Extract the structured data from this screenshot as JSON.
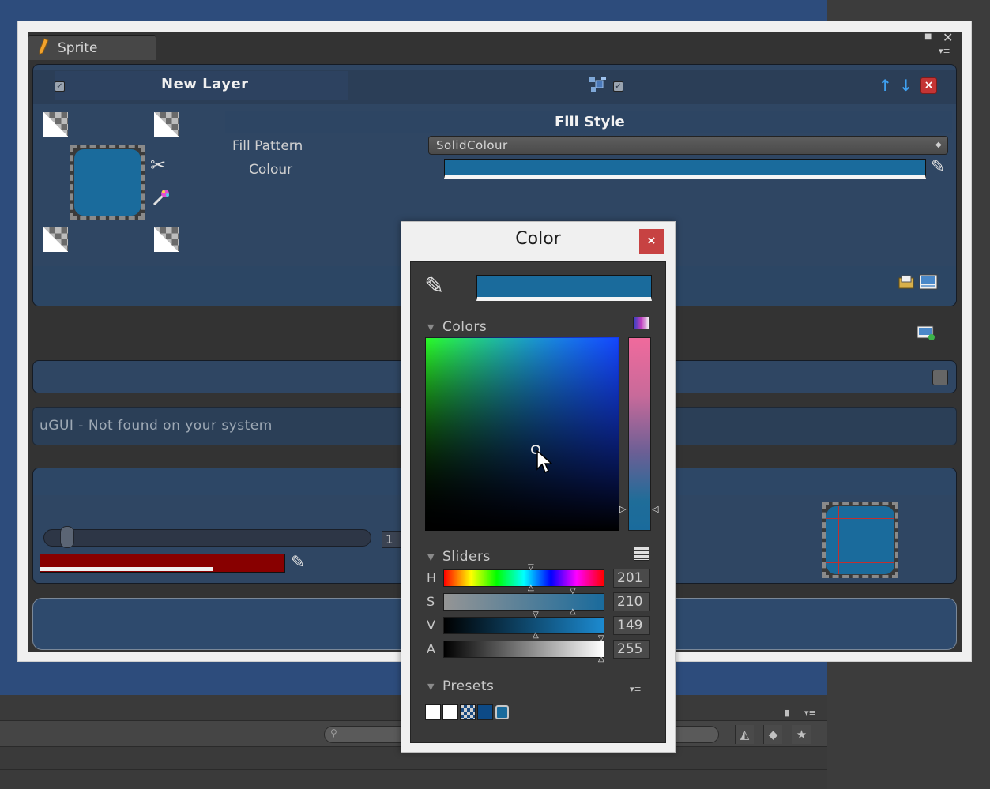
{
  "sprite_window": {
    "tab_title": "Sprite",
    "layer": {
      "name": "New Layer",
      "enabled": true,
      "fill_style_title": "Fill Style",
      "fill_pattern_label": "Fill Pattern",
      "fill_pattern_value": "SolidColour",
      "colour_label": "Colour",
      "colour_hex": "#1a6b9c"
    },
    "ugui_message": "uGUI - Not found on your system",
    "size_value": "1",
    "secondary_colour_hex": "#880000"
  },
  "color_dialog": {
    "title": "Color",
    "close_label": "×",
    "current_colour_hex": "#1a6b9c",
    "sections": {
      "colors": "Colors",
      "sliders": "Sliders",
      "presets": "Presets"
    },
    "sliders": [
      {
        "letter": "H",
        "value": "201"
      },
      {
        "letter": "S",
        "value": "210"
      },
      {
        "letter": "V",
        "value": "149"
      },
      {
        "letter": "A",
        "value": "255"
      }
    ],
    "presets": [
      "#ffffff",
      "#ffffff",
      "checker",
      "#0d4a86"
    ]
  },
  "icons": {
    "move_up": "↑",
    "move_down": "↓",
    "delete": "×",
    "check": "✓",
    "tools": "✂",
    "picker": "✎",
    "dropdown": "▴▾",
    "triangle": "▼",
    "menu": "▾≡",
    "window_close": "✕",
    "window_max": "■",
    "lock": "🔒",
    "search": "⚲"
  }
}
